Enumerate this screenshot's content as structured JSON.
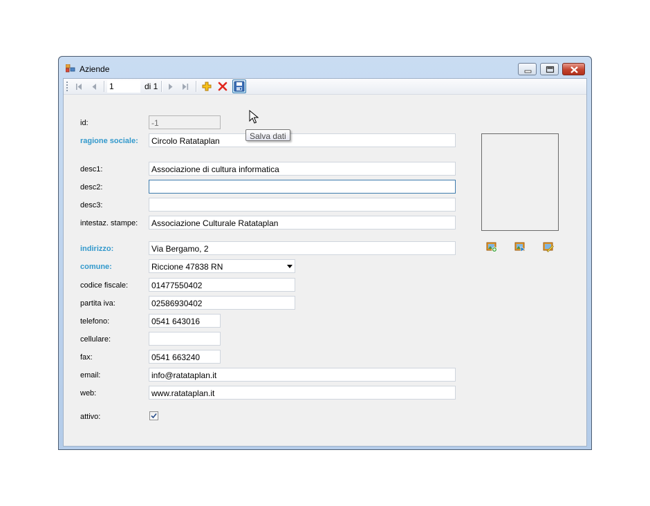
{
  "window": {
    "title": "Aziende",
    "controls": {
      "minimize": "minimize-icon",
      "maximize": "maximize-icon",
      "close": "close-icon"
    }
  },
  "navigator": {
    "position": "1",
    "of_label": "di 1",
    "buttons": [
      "move-first-icon",
      "move-previous-icon",
      "move-next-icon",
      "move-last-icon",
      "add-new-icon",
      "delete-icon",
      "save-icon"
    ]
  },
  "tooltip": "Salva dati",
  "form": {
    "id": {
      "label": "id:",
      "value": "-1"
    },
    "ragione_sociale": {
      "label": "ragione sociale:",
      "value": "Circolo Ratataplan"
    },
    "desc1": {
      "label": "desc1:",
      "value": "Associazione di cultura informatica"
    },
    "desc2": {
      "label": "desc2:",
      "value": ""
    },
    "desc3": {
      "label": "desc3:",
      "value": ""
    },
    "intestaz_stampe": {
      "label": "intestaz. stampe:",
      "value": "Associazione Culturale Ratataplan"
    },
    "indirizzo": {
      "label": "indirizzo:",
      "value": "Via Bergamo, 2"
    },
    "comune": {
      "label": "comune:",
      "value": "Riccione 47838 RN"
    },
    "codice_fiscale": {
      "label": "codice fiscale:",
      "value": "01477550402"
    },
    "partita_iva": {
      "label": "partita iva:",
      "value": "02586930402"
    },
    "telefono": {
      "label": "telefono:",
      "value": "0541 643016"
    },
    "cellulare": {
      "label": "cellulare:",
      "value": ""
    },
    "fax": {
      "label": "fax:",
      "value": "0541 663240"
    },
    "email": {
      "label": "email:",
      "value": "info@ratataplan.it"
    },
    "web": {
      "label": "web:",
      "value": "www.ratataplan.it"
    },
    "attivo": {
      "label": "attivo:",
      "checked": true
    }
  },
  "image_buttons": [
    "add-image-icon",
    "load-image-icon",
    "edit-image-icon"
  ],
  "colors": {
    "required_label": "#3399cc",
    "titlebar": "#c9dcf2",
    "client_bg": "#f0f0f0"
  }
}
